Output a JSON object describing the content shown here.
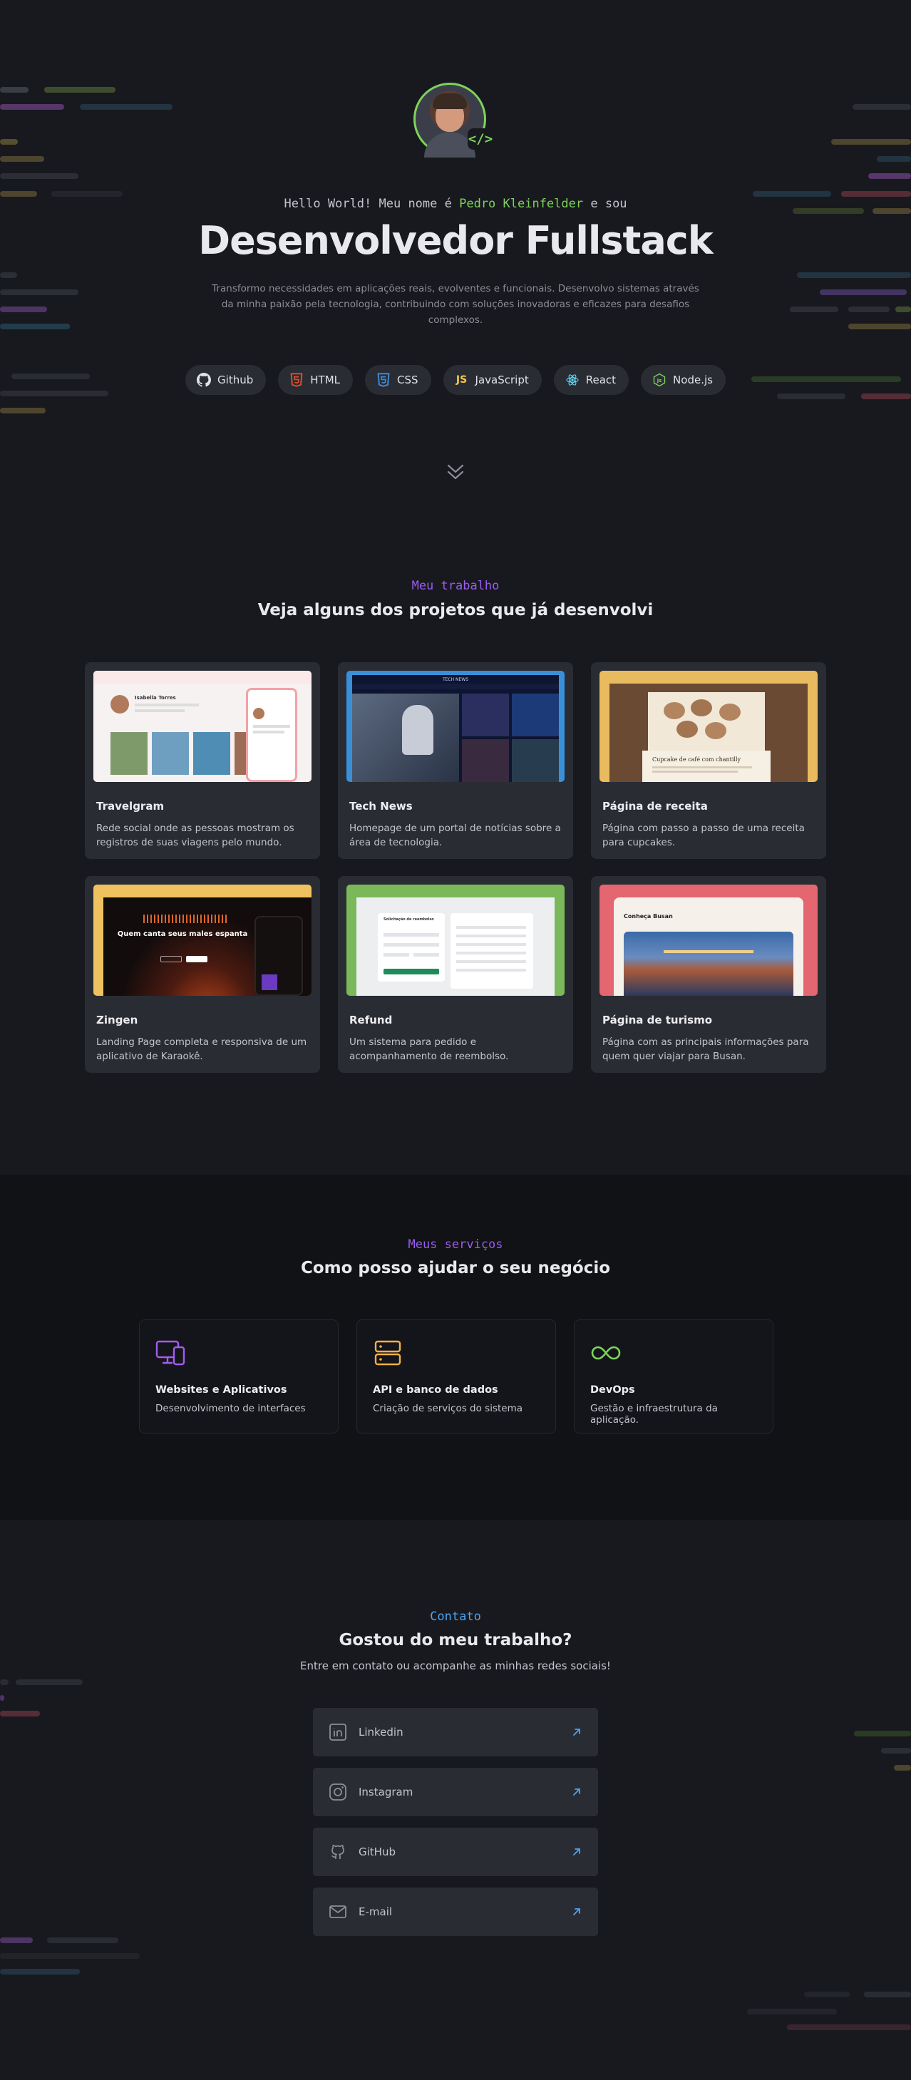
{
  "hero": {
    "hello_prefix": "Hello World! Meu nome é",
    "name": "Pedro Kleinfelder",
    "hello_suffix": "e sou",
    "title": "Desenvolvedor Fullstack",
    "subtitle": "Transformo necessidades em aplicações reais, evolventes e funcionais. Desenvolvo sistemas através da minha paixão pela tecnologia, contribuindo com soluções inovadoras e eficazes para desafios complexos.",
    "code_badge": "</>",
    "techs": [
      {
        "label": "Github",
        "icon": "github-icon",
        "color": "#e1e1e6"
      },
      {
        "label": "HTML",
        "icon": "html5-icon",
        "color": "#e34f26"
      },
      {
        "label": "CSS",
        "icon": "css3-icon",
        "color": "#3d8fe0"
      },
      {
        "label": "JavaScript",
        "icon": "js-icon",
        "color": "#f7c948"
      },
      {
        "label": "React",
        "icon": "react-icon",
        "color": "#61dafb"
      },
      {
        "label": "Node.js",
        "icon": "nodejs-icon",
        "color": "#7dd35b"
      }
    ]
  },
  "work": {
    "kicker": "Meu trabalho",
    "title": "Veja alguns dos projetos que já desenvolvi",
    "projects": [
      {
        "title": "Travelgram",
        "desc": "Rede social onde as pessoas mostram os registros de suas viagens pelo mundo.",
        "bg": "#e0626d",
        "thumb_text": "Isabella Torres"
      },
      {
        "title": "Tech News",
        "desc": "Homepage de um portal de notícias sobre a área de tecnologia.",
        "bg": "#3a8fd9",
        "thumb_text": "TECH NEWS"
      },
      {
        "title": "Página de receita",
        "desc": "Página com passo a passo de uma receita para cupcakes.",
        "bg": "#e9bb5f",
        "thumb_text": "Cupcake de café com chantilly"
      },
      {
        "title": "Zingen",
        "desc": "Landing Page completa e responsiva de um aplicativo de Karaokê.",
        "bg": "#efc25f",
        "thumb_text": "Quem canta seus males espanta"
      },
      {
        "title": "Refund",
        "desc": "Um sistema para pedido e acompanhamento de reembolso.",
        "bg": "#7ab85a",
        "thumb_text": "Solicitação de reembolso"
      },
      {
        "title": "Página de turismo",
        "desc": "Página com as principais informações para quem quer viajar para Busan.",
        "bg": "#e36670",
        "thumb_text": "Conheça Busan"
      }
    ]
  },
  "services": {
    "kicker": "Meus serviços",
    "title": "Como posso ajudar o seu negócio",
    "items": [
      {
        "name": "Websites e Aplicativos",
        "desc": "Desenvolvimento de interfaces",
        "icon": "devices-icon",
        "color": "#a35cf0"
      },
      {
        "name": "API e banco de dados",
        "desc": "Criação de serviços do sistema",
        "icon": "server-icon",
        "color": "#f7b048"
      },
      {
        "name": "DevOps",
        "desc": "Gestão e infraestrutura da aplicação.",
        "icon": "infinity-icon",
        "color": "#7dd35b"
      }
    ]
  },
  "contact": {
    "kicker": "Contato",
    "title": "Gostou do meu trabalho?",
    "subtitle": "Entre em contato ou acompanhe as minhas redes sociais!",
    "links": [
      {
        "label": "Linkedin",
        "icon": "linkedin-icon"
      },
      {
        "label": "Instagram",
        "icon": "instagram-icon"
      },
      {
        "label": "GitHub",
        "icon": "github-icon"
      },
      {
        "label": "E-mail",
        "icon": "mail-icon"
      }
    ],
    "accent": "#4aa4f5"
  }
}
